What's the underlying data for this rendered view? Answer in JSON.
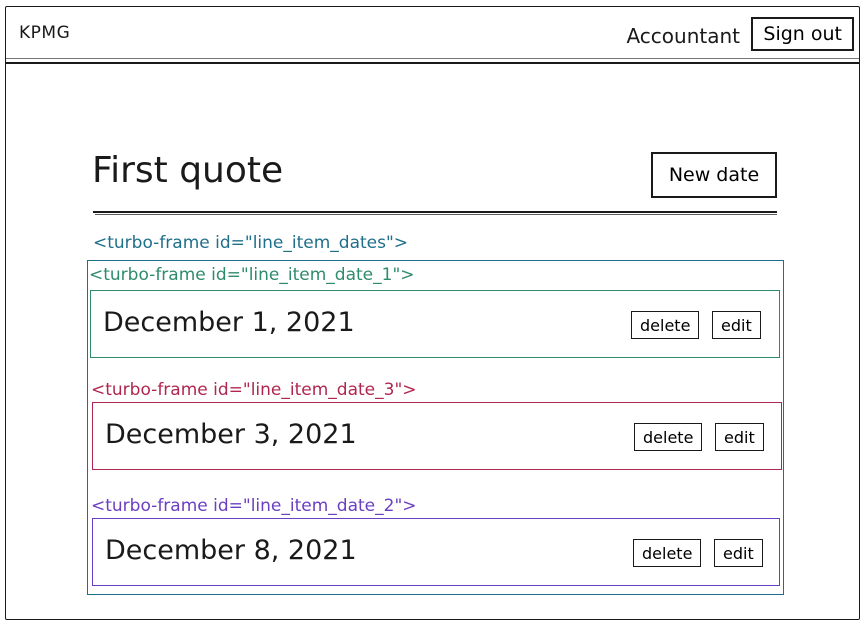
{
  "header": {
    "logo": "KPMG",
    "role": "Accountant",
    "sign_out_label": "Sign out"
  },
  "page": {
    "title": "First quote",
    "new_date_label": "New date"
  },
  "annotations": {
    "outer": "<turbo-frame id=\"line_item_dates\">",
    "item_1": "<turbo-frame id=\"line_item_date_1\">",
    "item_3": "<turbo-frame id=\"line_item_date_3\">",
    "item_2": "<turbo-frame id=\"line_item_date_2\">"
  },
  "items": [
    {
      "date": "December 1, 2021",
      "delete_label": "delete",
      "edit_label": "edit",
      "color": "#2e8b6b"
    },
    {
      "date": "December 3, 2021",
      "delete_label": "delete",
      "edit_label": "edit",
      "color": "#b0264f"
    },
    {
      "date": "December 8, 2021",
      "delete_label": "delete",
      "edit_label": "edit",
      "color": "#6a3fc1"
    }
  ],
  "colors": {
    "outer_frame": "#1f6f8b",
    "item_1": "#2e8b6b",
    "item_3": "#b0264f",
    "item_2": "#6a3fc1"
  }
}
